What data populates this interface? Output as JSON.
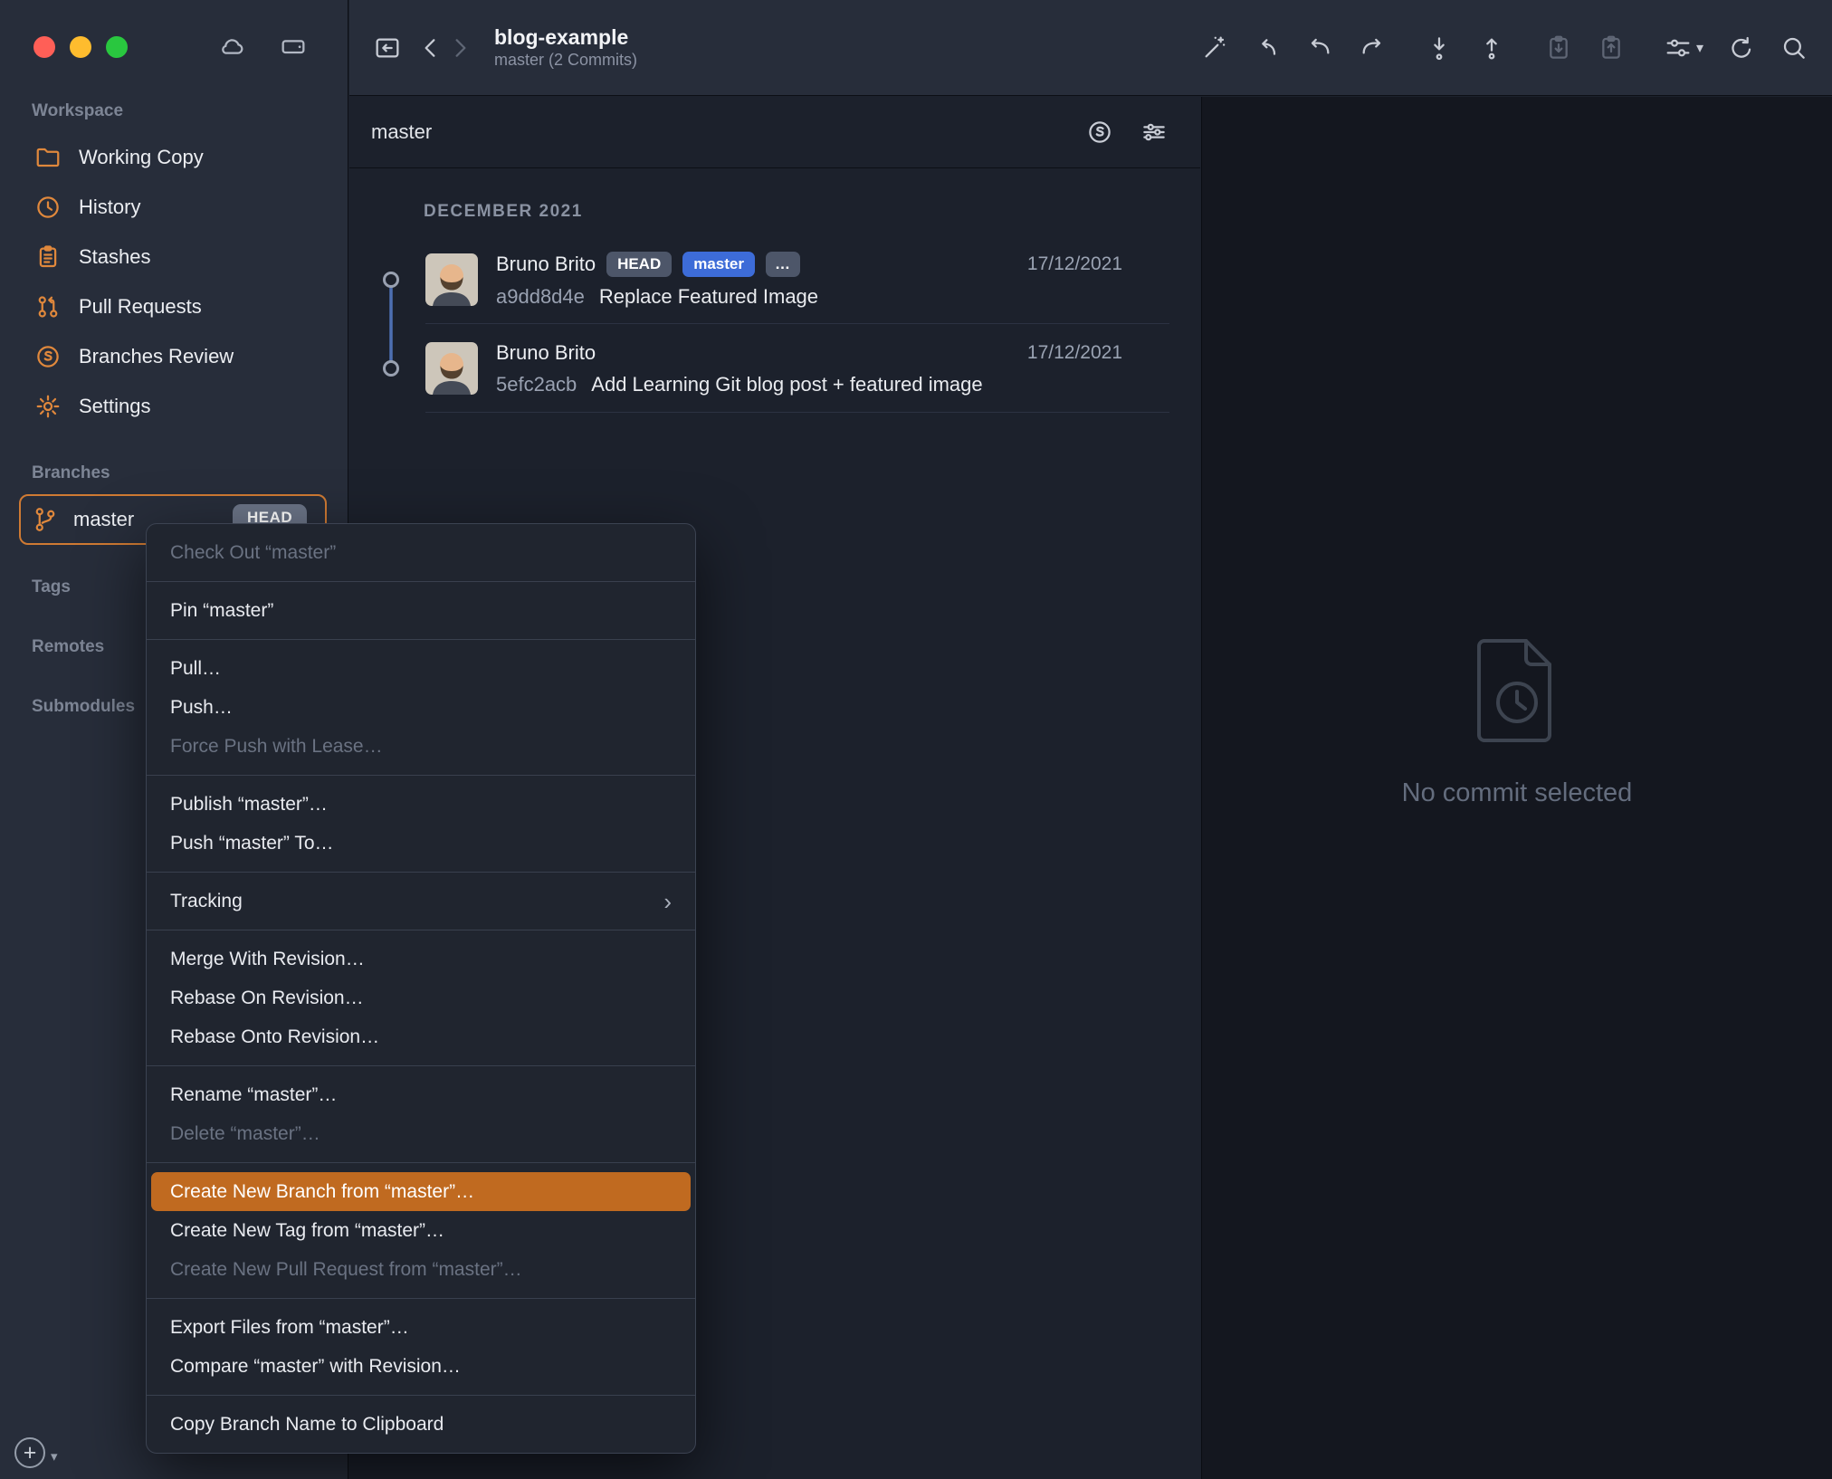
{
  "window": {
    "title": "blog-example",
    "subtitle": "master (2 Commits)"
  },
  "colors": {
    "accent_orange": "#cf7a33",
    "branch_badge_blue": "#3d6cd8",
    "highlight_orange": "#c06a20"
  },
  "sidebar": {
    "workspace_label": "Workspace",
    "workspace_items": [
      {
        "label": "Working Copy",
        "icon": "folder-icon"
      },
      {
        "label": "History",
        "icon": "history-icon"
      },
      {
        "label": "Stashes",
        "icon": "clipboard-icon"
      },
      {
        "label": "Pull Requests",
        "icon": "pull-request-icon"
      },
      {
        "label": "Branches Review",
        "icon": "branches-review-icon"
      },
      {
        "label": "Settings",
        "icon": "gear-icon"
      }
    ],
    "branches_label": "Branches",
    "branch_master": {
      "label": "master",
      "badge": "HEAD"
    },
    "tags_label": "Tags",
    "remotes_label": "Remotes",
    "submodules_label": "Submodules",
    "plus_label": "+"
  },
  "filter_bar": {
    "query": "master"
  },
  "commits": {
    "month_header": "DECEMBER 2021",
    "rows": [
      {
        "author": "Bruno Brito",
        "badge_head": "HEAD",
        "badge_branch": "master",
        "badge_more": "…",
        "date": "17/12/2021",
        "hash": "a9dd8d4e",
        "message": "Replace Featured Image"
      },
      {
        "author": "Bruno Brito",
        "date": "17/12/2021",
        "hash": "5efc2acb",
        "message": "Add Learning Git blog post + featured image"
      }
    ]
  },
  "detail": {
    "empty_message": "No commit selected"
  },
  "context_menu": {
    "groups": [
      {
        "items": [
          {
            "label": "Check Out “master”"
          }
        ]
      },
      {
        "items": [
          {
            "label": "Pin “master”"
          }
        ]
      },
      {
        "items": [
          {
            "label": "Pull…"
          },
          {
            "label": "Push…"
          },
          {
            "label": "Force Push with Lease…"
          }
        ]
      },
      {
        "items": [
          {
            "label": "Publish “master”…"
          },
          {
            "label": "Push “master” To…"
          }
        ]
      },
      {
        "items": [
          {
            "label": "Tracking"
          }
        ]
      },
      {
        "items": [
          {
            "label": "Merge With Revision…"
          },
          {
            "label": "Rebase On Revision…"
          },
          {
            "label": "Rebase Onto Revision…"
          }
        ]
      },
      {
        "items": [
          {
            "label": "Rename “master”…"
          },
          {
            "label": "Delete “master”…"
          }
        ]
      },
      {
        "items": [
          {
            "label": "Create New Branch from “master”…"
          },
          {
            "label": "Create New Tag from “master”…"
          },
          {
            "label": "Create New Pull Request from “master”…"
          }
        ]
      },
      {
        "items": [
          {
            "label": "Export Files from “master”…"
          },
          {
            "label": "Compare “master” with Revision…"
          }
        ]
      },
      {
        "items": [
          {
            "label": "Copy Branch Name to Clipboard"
          }
        ]
      }
    ]
  }
}
